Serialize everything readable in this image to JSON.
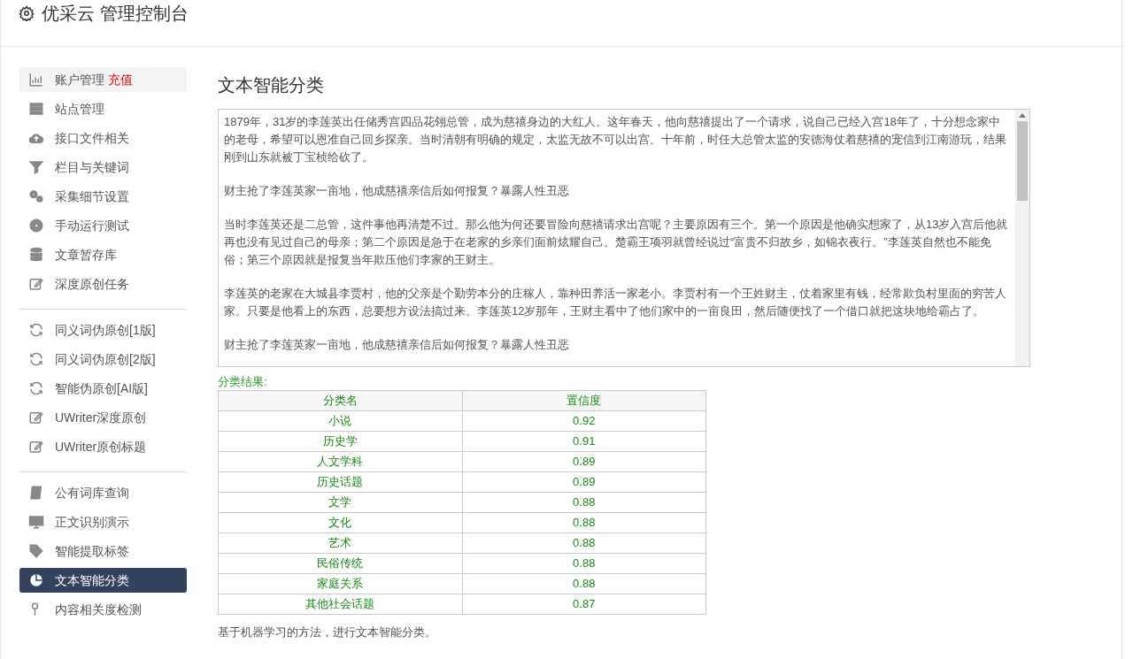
{
  "header": {
    "title": "优采云 管理控制台"
  },
  "sidebar": {
    "groups": [
      [
        {
          "label": "账户管理",
          "badge": "充值",
          "highlighted": true,
          "selected": false
        },
        {
          "label": "站点管理",
          "highlighted": false,
          "selected": false
        },
        {
          "label": "接口文件相关",
          "highlighted": false,
          "selected": false
        },
        {
          "label": "栏目与关键词",
          "highlighted": false,
          "selected": false
        },
        {
          "label": "采集细节设置",
          "highlighted": false,
          "selected": false
        },
        {
          "label": "手动运行测试",
          "highlighted": false,
          "selected": false
        },
        {
          "label": "文章暂存库",
          "highlighted": false,
          "selected": false
        },
        {
          "label": "深度原创任务",
          "highlighted": false,
          "selected": false
        }
      ],
      [
        {
          "label": "同义词伪原创[1版]",
          "highlighted": false,
          "selected": false
        },
        {
          "label": "同义词伪原创[2版]",
          "highlighted": false,
          "selected": false
        },
        {
          "label": "智能伪原创[AI版]",
          "highlighted": false,
          "selected": false
        },
        {
          "label": "UWriter深度原创",
          "highlighted": false,
          "selected": false
        },
        {
          "label": "UWriter原创标题",
          "highlighted": false,
          "selected": false
        }
      ],
      [
        {
          "label": "公有词库查询",
          "highlighted": false,
          "selected": false
        },
        {
          "label": "正文识别演示",
          "highlighted": false,
          "selected": false
        },
        {
          "label": "智能提取标签",
          "highlighted": false,
          "selected": false
        },
        {
          "label": "文本智能分类",
          "highlighted": false,
          "selected": true
        },
        {
          "label": "内容相关度检测",
          "highlighted": false,
          "selected": false
        }
      ]
    ]
  },
  "main": {
    "title": "文本智能分类",
    "input_text": [
      "1879年，31岁的李莲英出任储秀宫四品花翎总管，成为慈禧身边的大红人。这年春天，他向慈禧提出了一个请求，说自己已经入宫18年了，十分想念家中的老母，希望可以恩准自己回乡探亲。当时清朝有明确的规定，太监无故不可以出宫。十年前，时任大总管太监的安德海仗着慈禧的宠信到江南游玩，结果刚到山东就被丁宝桢给砍了。",
      "财主抢了李莲英家一亩地，他成慈禧亲信后如何报复？暴露人性丑恶",
      "当时李莲英还是二总管，这件事他再清楚不过。那么他为何还要冒险向慈禧请求出宫呢？主要原因有三个。第一个原因是他确实想家了，从13岁入宫后他就再也没有见过自己的母亲；第二个原因是急于在老家的乡亲们面前炫耀自己。楚霸王项羽就曾经说过“富贵不归故乡，如锦衣夜行。”李莲英自然也不能免俗；第三个原因就是报复当年欺压他们李家的王财主。",
      "李莲英的老家在大城县李贾村，他的父亲是个勤劳本分的庄稼人，靠种田养活一家老小。李贾村有一个王姓财主，仗着家里有钱，经常欺负村里面的穷苦人家。只要是他看上的东西，总要想方设法搞过来。李莲英12岁那年，王财主看中了他们家中的一亩良田，然后随便找了一个借口就把这块地给霸占了。",
      "财主抢了李莲英家一亩地，他成慈禧亲信后如何报复？暴露人性丑恶"
    ],
    "result_label": "分类结果:",
    "table": {
      "columns": [
        "分类名",
        "置信度"
      ],
      "rows": [
        [
          "小说",
          "0.92"
        ],
        [
          "历史学",
          "0.91"
        ],
        [
          "人文学科",
          "0.89"
        ],
        [
          "历史话题",
          "0.89"
        ],
        [
          "文学",
          "0.88"
        ],
        [
          "文化",
          "0.88"
        ],
        [
          "艺术",
          "0.88"
        ],
        [
          "民俗传统",
          "0.88"
        ],
        [
          "家庭关系",
          "0.88"
        ],
        [
          "其他社会话题",
          "0.87"
        ]
      ]
    },
    "footnote": "基于机器学习的方法，进行文本智能分类。"
  }
}
